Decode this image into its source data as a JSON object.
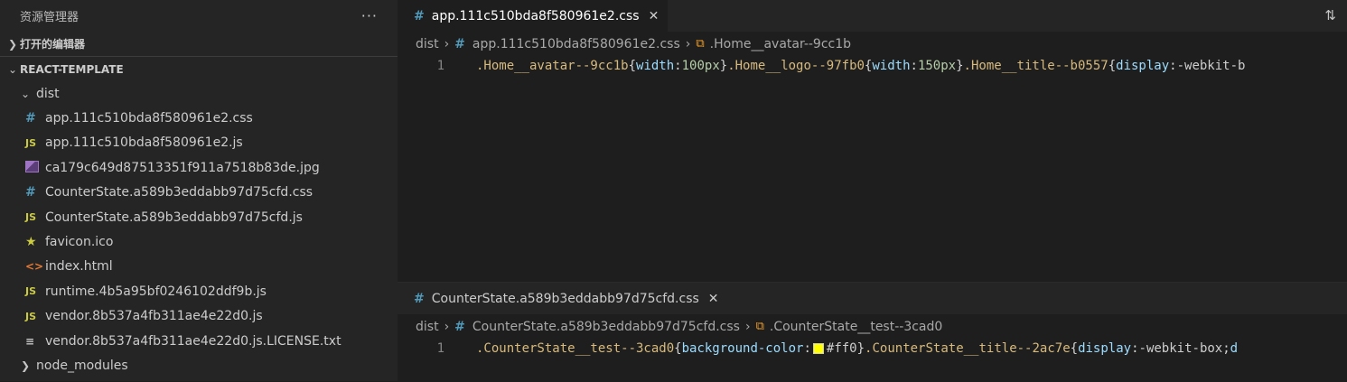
{
  "sidebar": {
    "title": "资源管理器",
    "more": "···",
    "open_editors": "打开的编辑器",
    "project": "REACT-TEMPLATE",
    "folder_dist": "dist",
    "files": [
      {
        "name": "app.111c510bda8f580961e2.css",
        "icon": "#"
      },
      {
        "name": "app.111c510bda8f580961e2.js",
        "icon": "JS"
      },
      {
        "name": "ca179c649d87513351f911a7518b83de.jpg",
        "icon": "image"
      },
      {
        "name": "CounterState.a589b3eddabb97d75cfd.css",
        "icon": "#"
      },
      {
        "name": "CounterState.a589b3eddabb97d75cfd.js",
        "icon": "JS"
      },
      {
        "name": "favicon.ico",
        "icon": "★"
      },
      {
        "name": "index.html",
        "icon": "<>"
      },
      {
        "name": "runtime.4b5a95bf0246102ddf9b.js",
        "icon": "JS"
      },
      {
        "name": "vendor.8b537a4fb311ae4e22d0.js",
        "icon": "JS"
      },
      {
        "name": "vendor.8b537a4fb311ae4e22d0.js.LICENSE.txt",
        "icon": "≡"
      }
    ],
    "folder_node_modules": "node_modules"
  },
  "editor1": {
    "tab_label": "app.111c510bda8f580961e2.css",
    "breadcrumb": {
      "folder": "dist",
      "file": "app.111c510bda8f580961e2.css",
      "symbol": ".Home__avatar--9cc1b"
    },
    "line_number": "1",
    "code": {
      "s1": ".Home__avatar--9cc1b",
      "p1": "width",
      "v1": "100px",
      "s2": ".Home__logo--97fb0",
      "p2": "width",
      "v2": "150px",
      "s3": ".Home__title--b0557",
      "p3": "display",
      "v3": "-webkit-b"
    }
  },
  "editor2": {
    "tab_label": "CounterState.a589b3eddabb97d75cfd.css",
    "breadcrumb": {
      "folder": "dist",
      "file": "CounterState.a589b3eddabb97d75cfd.css",
      "symbol": ".CounterState__test--3cad0"
    },
    "line_number": "1",
    "code": {
      "s1": ".CounterState__test--3cad0",
      "p1": "background-color",
      "v1": "#ff0",
      "s2": ".CounterState__title--2ac7e",
      "p2": "display",
      "v2": "-webkit-box",
      "tail": "d"
    }
  },
  "colors": {
    "swatch": "#ffff00"
  }
}
